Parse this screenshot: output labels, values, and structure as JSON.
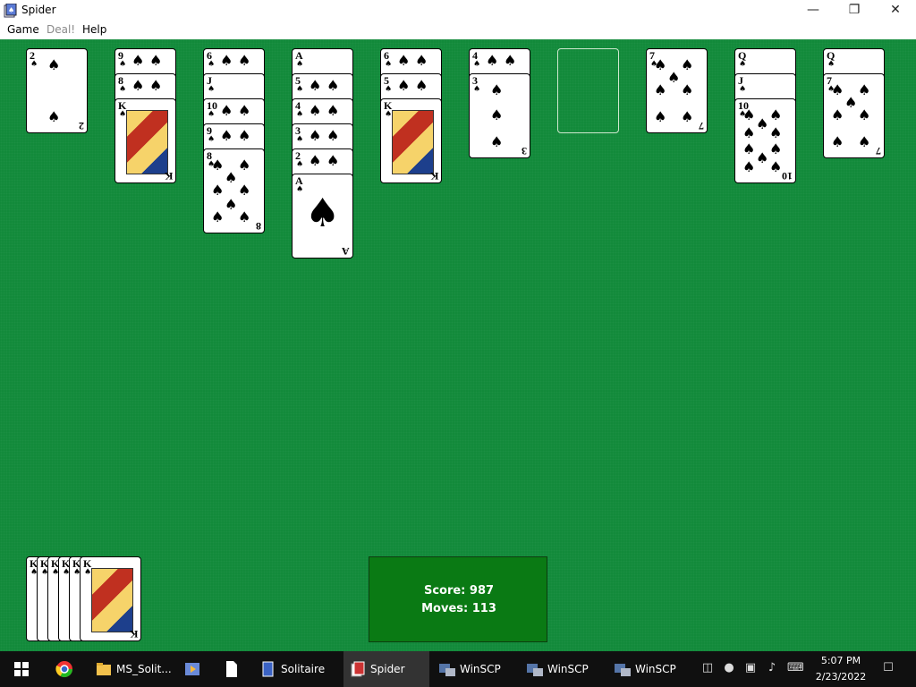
{
  "window": {
    "title": "Spider"
  },
  "menu": [
    "Game",
    "Deal!",
    "Help"
  ],
  "status": {
    "score_text": "Score:  987",
    "moves_text": "Moves:  113"
  },
  "tableau": {
    "col1": {
      "cards": [
        {
          "rank": "2"
        }
      ]
    },
    "col2": {
      "cards": [
        {
          "rank": "9"
        },
        {
          "rank": "8"
        },
        {
          "rank": "K"
        }
      ]
    },
    "col3": {
      "cards": [
        {
          "rank": "6"
        },
        {
          "rank": "J"
        },
        {
          "rank": "10"
        },
        {
          "rank": "9"
        },
        {
          "rank": "8"
        }
      ]
    },
    "col4": {
      "cards": [
        {
          "rank": "A"
        },
        {
          "rank": "5"
        },
        {
          "rank": "4"
        },
        {
          "rank": "3"
        },
        {
          "rank": "2"
        },
        {
          "rank": "A"
        }
      ]
    },
    "col5": {
      "cards": [
        {
          "rank": "6"
        },
        {
          "rank": "5"
        },
        {
          "rank": "K"
        }
      ]
    },
    "col6": {
      "cards": [
        {
          "rank": "4"
        },
        {
          "rank": "3"
        }
      ]
    },
    "col7": {
      "cards": []
    },
    "col8": {
      "cards": [
        {
          "rank": "7"
        }
      ]
    },
    "col9": {
      "cards": [
        {
          "rank": "Q"
        },
        {
          "rank": "J"
        },
        {
          "rank": "10"
        }
      ]
    },
    "col10": {
      "cards": [
        {
          "rank": "Q"
        },
        {
          "rank": "7"
        }
      ]
    }
  },
  "completed_stack": {
    "ranks": [
      "K",
      "K",
      "K",
      "K",
      "K",
      "K"
    ]
  },
  "taskbar": {
    "items": [
      {
        "label": "MS_Solit...",
        "icon": "folder-icon"
      },
      {
        "label": "",
        "icon": "media-icon"
      },
      {
        "label": "",
        "icon": "file-icon"
      },
      {
        "label": "Solitaire",
        "icon": "solitaire-icon"
      },
      {
        "label": "Spider",
        "icon": "spider-icon"
      },
      {
        "label": "WinSCP",
        "icon": "winscp-icon"
      },
      {
        "label": "WinSCP",
        "icon": "winscp-icon"
      },
      {
        "label": "WinSCP",
        "icon": "winscp-icon"
      }
    ],
    "time": "5:07 PM",
    "date": "2/23/2022"
  },
  "colors": {
    "felt": "#128a3a",
    "score_box": "#0a7a14"
  }
}
